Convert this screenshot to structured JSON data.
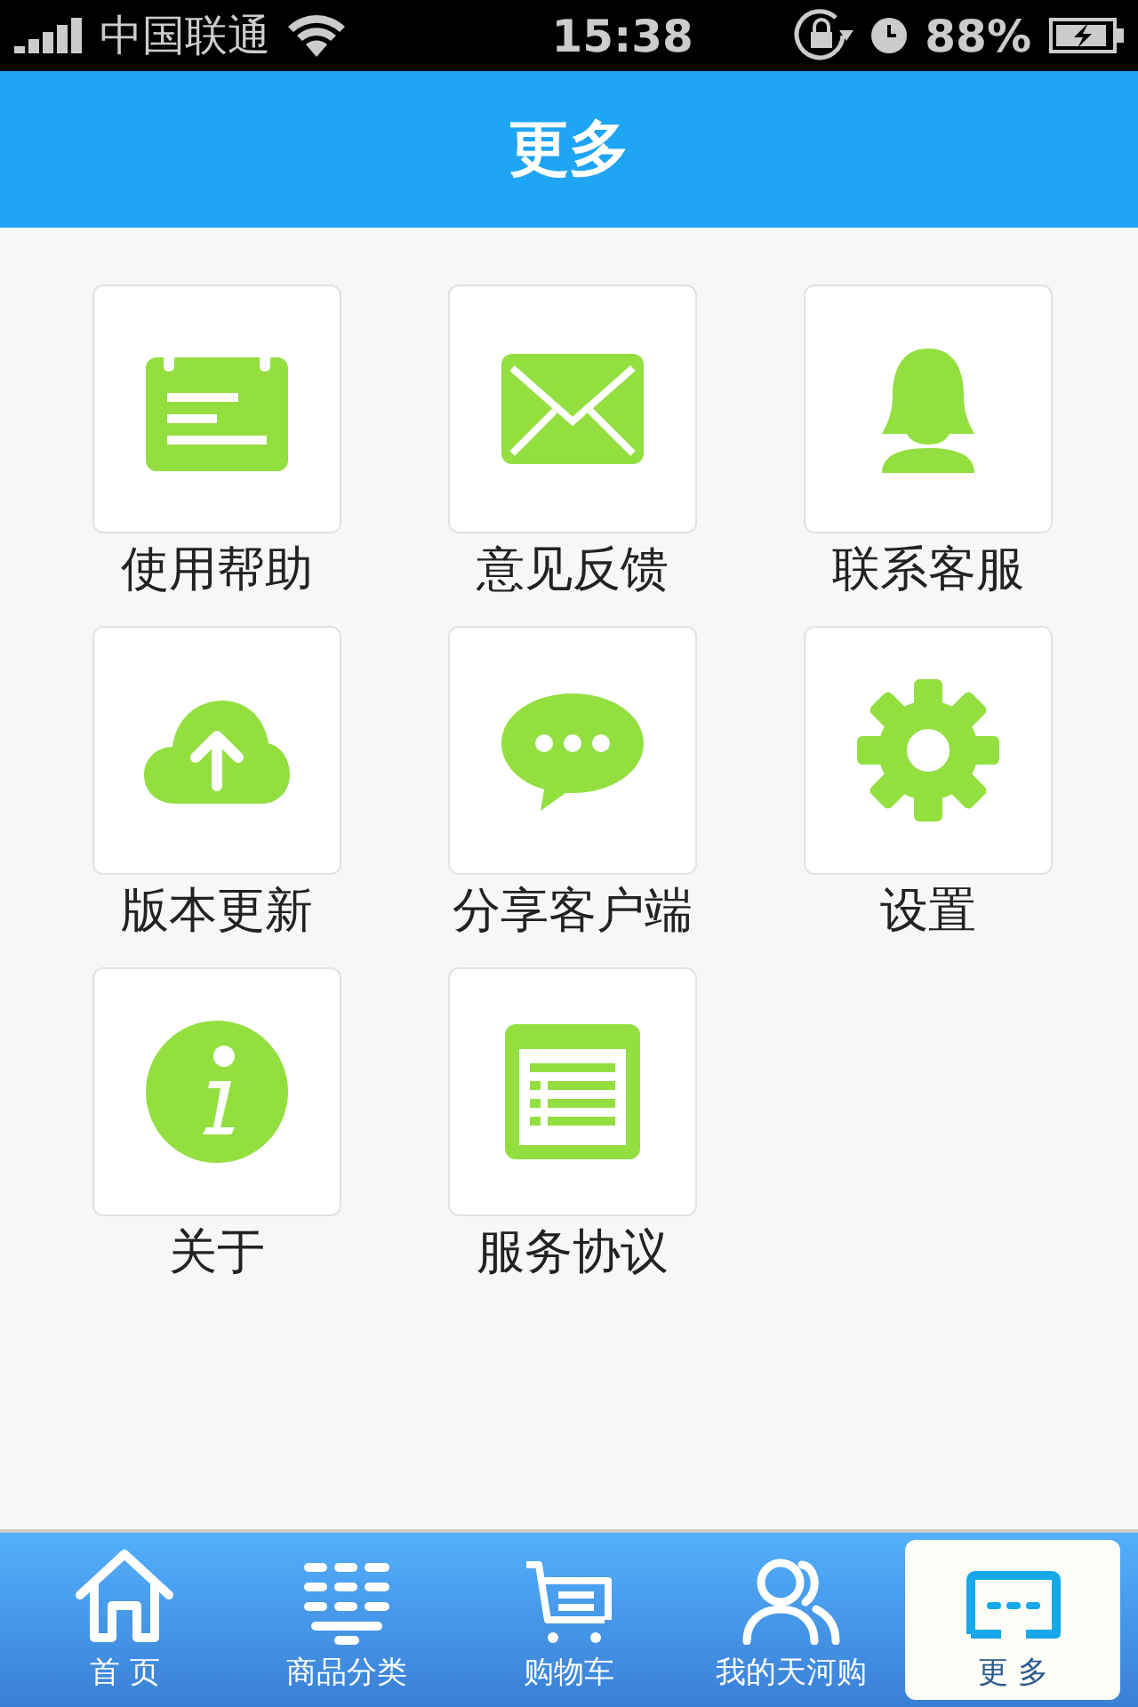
{
  "status_bar": {
    "carrier": "中国联通",
    "time": "15:38",
    "battery": "88%"
  },
  "header": {
    "title": "更多"
  },
  "menu_items": [
    {
      "label": "使用帮助"
    },
    {
      "label": "意见反馈"
    },
    {
      "label": "联系客服"
    },
    {
      "label": "版本更新"
    },
    {
      "label": "分享客户端"
    },
    {
      "label": "设置"
    },
    {
      "label": "关于"
    },
    {
      "label": "服务协议"
    }
  ],
  "tab_bar": [
    {
      "label": "首 页",
      "selected": false
    },
    {
      "label": "商品分类",
      "selected": false
    },
    {
      "label": "购物车",
      "selected": false
    },
    {
      "label": "我的天河购",
      "selected": false
    },
    {
      "label": "更 多",
      "selected": true
    }
  ]
}
